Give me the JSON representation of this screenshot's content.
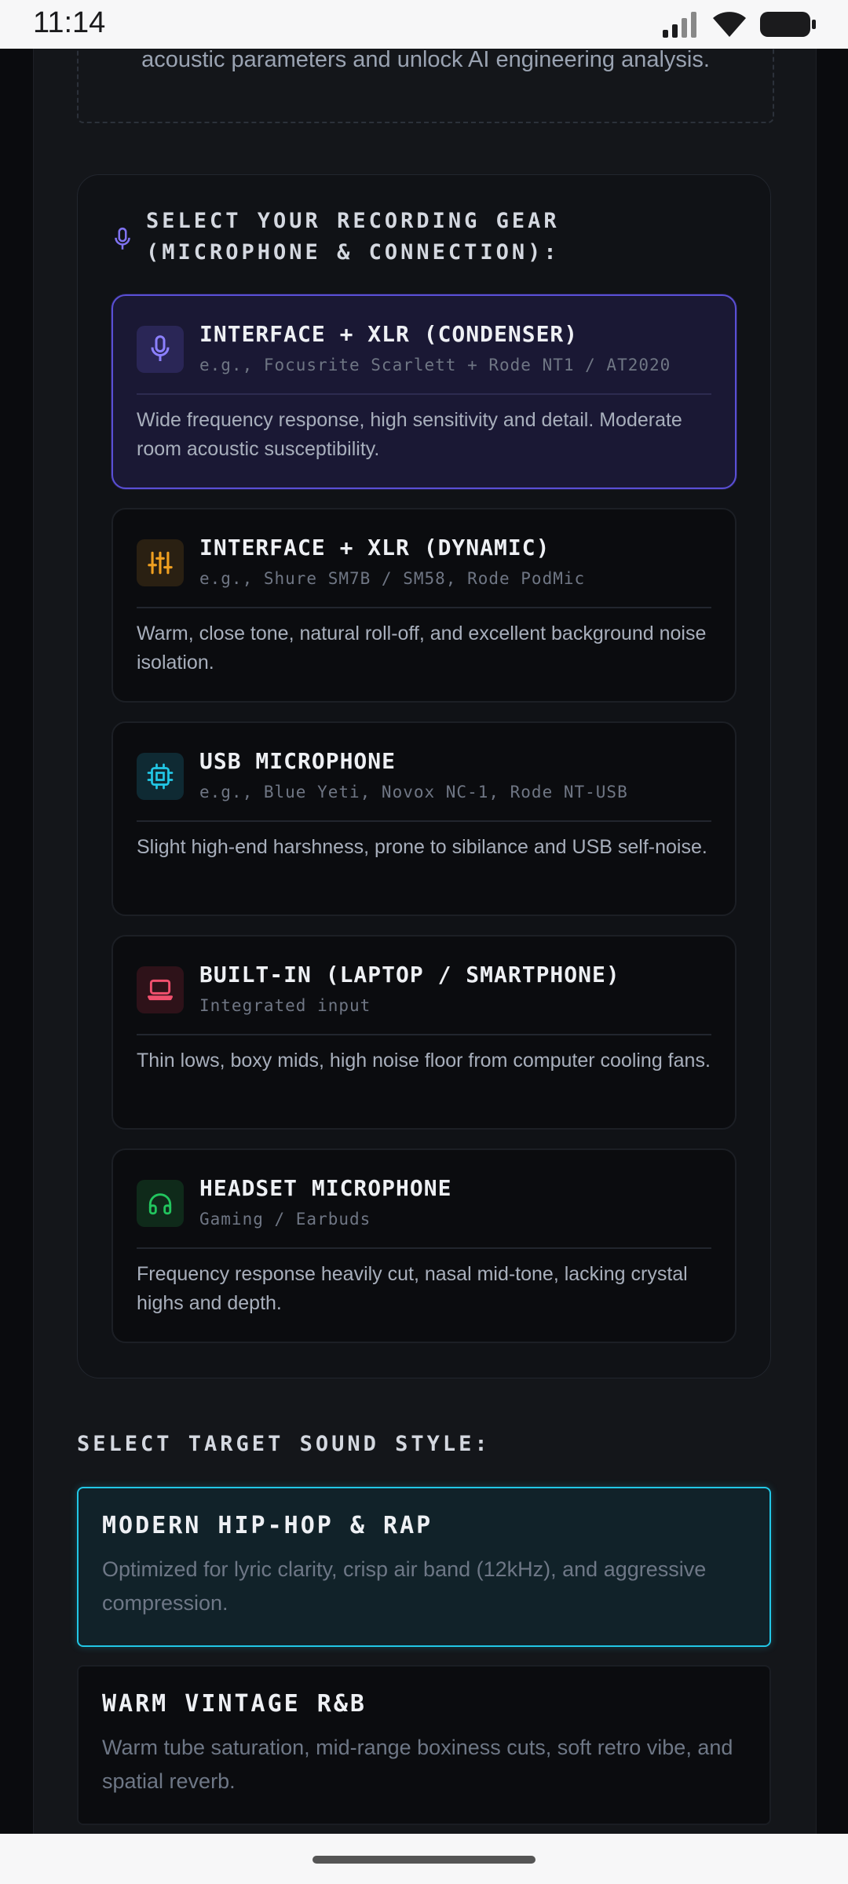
{
  "status_bar": {
    "time": "11:14"
  },
  "upload": {
    "text": "acoustic parameters and unlock AI engineering analysis."
  },
  "gear_section": {
    "heading": "SELECT YOUR RECORDING GEAR (MICROPHONE & CONNECTION):",
    "icon": "microphone-icon",
    "options": [
      {
        "title": "INTERFACE + XLR (CONDENSER)",
        "subtitle": "e.g., Focusrite Scarlett + Rode NT1 / AT2020",
        "description": "Wide frequency response, high sensitivity and detail. Moderate room acoustic susceptibility.",
        "icon": "microphone-icon",
        "accent": "#7f72f0",
        "selected": true
      },
      {
        "title": "INTERFACE + XLR (DYNAMIC)",
        "subtitle": "e.g., Shure SM7B / SM58, Rode PodMic",
        "description": "Warm, close tone, natural roll-off, and excellent background noise isolation.",
        "icon": "sliders-icon",
        "accent": "#f0a020",
        "selected": false
      },
      {
        "title": "USB MICROPHONE",
        "subtitle": "e.g., Blue Yeti, Novox NC-1, Rode NT-USB",
        "description": "Slight high-end harshness, prone to sibilance and USB self-noise.",
        "icon": "chip-icon",
        "accent": "#22c7e6",
        "selected": false
      },
      {
        "title": "BUILT-IN (LAPTOP / SMARTPHONE)",
        "subtitle": "Integrated input",
        "description": "Thin lows, boxy mids, high noise floor from computer cooling fans.",
        "icon": "laptop-icon",
        "accent": "#f0506e",
        "selected": false
      },
      {
        "title": "HEADSET MICROPHONE",
        "subtitle": "Gaming / Earbuds",
        "description": "Frequency response heavily cut, nasal mid-tone, lacking crystal highs and depth.",
        "icon": "headphones-icon",
        "accent": "#22c55e",
        "selected": false
      }
    ]
  },
  "style_section": {
    "heading": "SELECT TARGET SOUND STYLE:",
    "options": [
      {
        "title": "MODERN HIP-HOP & RAP",
        "description": "Optimized for lyric clarity, crisp air band (12kHz), and aggressive compression.",
        "selected": true
      },
      {
        "title": "WARM VINTAGE R&B",
        "description": "Warm tube saturation, mid-range boxiness cuts, soft retro vibe, and spatial reverb.",
        "selected": false
      }
    ]
  }
}
